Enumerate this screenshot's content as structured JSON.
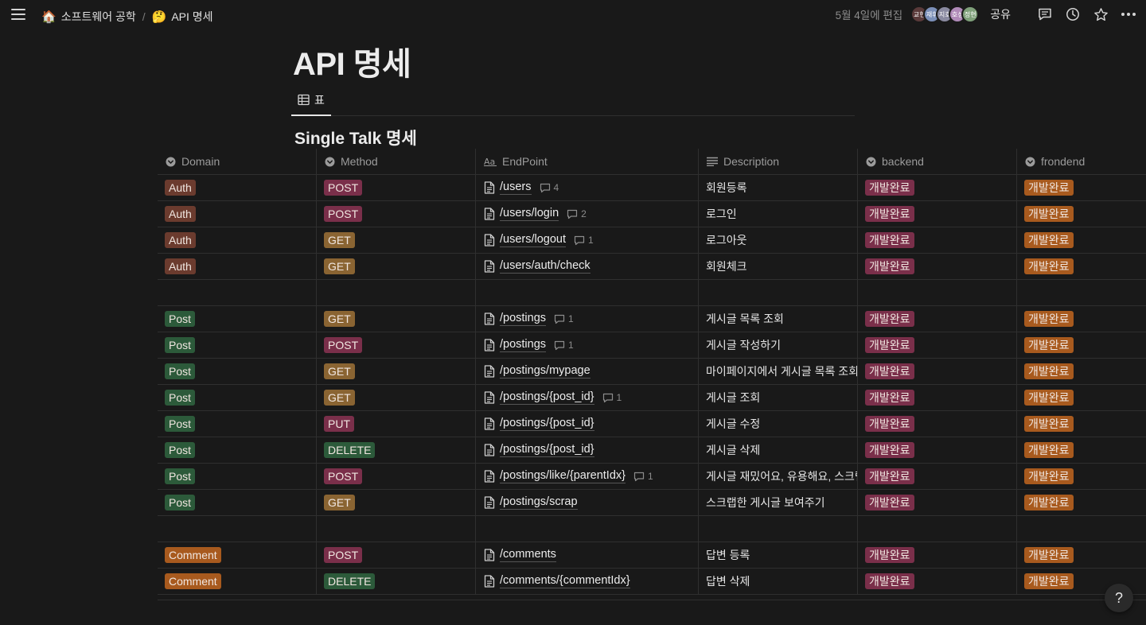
{
  "breadcrumb": [
    {
      "emoji": "🏠",
      "label": "소프트웨어 공학"
    },
    {
      "emoji": "🤔",
      "label": "API 명세"
    }
  ],
  "header": {
    "edited": "5월 4일에 편집",
    "share_label": "공유",
    "avatars": [
      {
        "label": "교현",
        "color": "#5a3a3a"
      },
      {
        "label": "재휘",
        "color": "#7b8fb8"
      },
      {
        "label": "지호",
        "color": "#8a8aa0"
      },
      {
        "label": "호성",
        "color": "#b08ab8"
      },
      {
        "label": "정현",
        "color": "#7fa07a"
      }
    ]
  },
  "page": {
    "title": "API 명세",
    "view_tab_label": "표",
    "db_title": "Single Talk 명세"
  },
  "columns": [
    {
      "label": "Domain",
      "icon": "select-icon"
    },
    {
      "label": "Method",
      "icon": "select-icon"
    },
    {
      "label": "EndPoint",
      "icon": "title-icon"
    },
    {
      "label": "Description",
      "icon": "text-icon"
    },
    {
      "label": "backend",
      "icon": "select-icon"
    },
    {
      "label": "frondend",
      "icon": "select-icon"
    }
  ],
  "colors": {
    "Auth": "#6b3b2e",
    "Post": "#2c5a3a",
    "Comment": "#a85a1e",
    "POST": "#7a2f4a",
    "GET": "#8a6432",
    "PUT": "#7a2f4a",
    "DELETE": "#2c5a3a",
    "backend": "#7a2f4a",
    "frontend": "#a85a1e"
  },
  "rows": [
    {
      "domain": "Auth",
      "method": "POST",
      "endpoint": "/users",
      "comments": "4",
      "description": "회원등록",
      "backend": "개발완료",
      "frontend": "개발완료"
    },
    {
      "domain": "Auth",
      "method": "POST",
      "endpoint": "/users/login",
      "comments": "2",
      "description": "로그인",
      "backend": "개발완료",
      "frontend": "개발완료"
    },
    {
      "domain": "Auth",
      "method": "GET",
      "endpoint": "/users/logout",
      "comments": "1",
      "description": "로그아웃",
      "backend": "개발완료",
      "frontend": "개발완료"
    },
    {
      "domain": "Auth",
      "method": "GET",
      "endpoint": "/users/auth/check",
      "comments": "",
      "description": "회원체크",
      "backend": "개발완료",
      "frontend": "개발완료"
    },
    {
      "empty": true
    },
    {
      "domain": "Post",
      "method": "GET",
      "endpoint": "/postings",
      "comments": "1",
      "description": "게시글 목록 조회",
      "backend": "개발완료",
      "frontend": "개발완료"
    },
    {
      "domain": "Post",
      "method": "POST",
      "endpoint": "/postings",
      "comments": "1",
      "description": "게시글 작성하기",
      "backend": "개발완료",
      "frontend": "개발완료"
    },
    {
      "domain": "Post",
      "method": "GET",
      "endpoint": "/postings/mypage",
      "comments": "",
      "description": "마이페이지에서 게시글 목록 조회",
      "backend": "개발완료",
      "frontend": "개발완료"
    },
    {
      "domain": "Post",
      "method": "GET",
      "endpoint": "/postings/{post_id}",
      "comments": "1",
      "description": "게시글 조회",
      "backend": "개발완료",
      "frontend": "개발완료"
    },
    {
      "domain": "Post",
      "method": "PUT",
      "endpoint": "/postings/{post_id}",
      "comments": "",
      "description": "게시글 수정",
      "backend": "개발완료",
      "frontend": "개발완료"
    },
    {
      "domain": "Post",
      "method": "DELETE",
      "endpoint": "/postings/{post_id}",
      "comments": "",
      "description": "게시글 삭제",
      "backend": "개발완료",
      "frontend": "개발완료"
    },
    {
      "domain": "Post",
      "method": "POST",
      "endpoint": "/postings/like/{parentIdx}",
      "comments": "1",
      "description": "게시글 재밌어요, 유용해요, 스크랩",
      "backend": "개발완료",
      "frontend": "개발완료"
    },
    {
      "domain": "Post",
      "method": "GET",
      "endpoint": "/postings/scrap",
      "comments": "",
      "description": "스크랩한 게시글 보여주기",
      "backend": "개발완료",
      "frontend": "개발완료"
    },
    {
      "empty": true
    },
    {
      "domain": "Comment",
      "method": "POST",
      "endpoint": "/comments",
      "comments": "",
      "description": "답변 등록",
      "backend": "개발완료",
      "frontend": "개발완료"
    },
    {
      "domain": "Comment",
      "method": "DELETE",
      "endpoint": "/comments/{commentIdx}",
      "comments": "",
      "description": "답변 삭제",
      "backend": "개발완료",
      "frontend": "개발완료"
    }
  ],
  "help_label": "?"
}
